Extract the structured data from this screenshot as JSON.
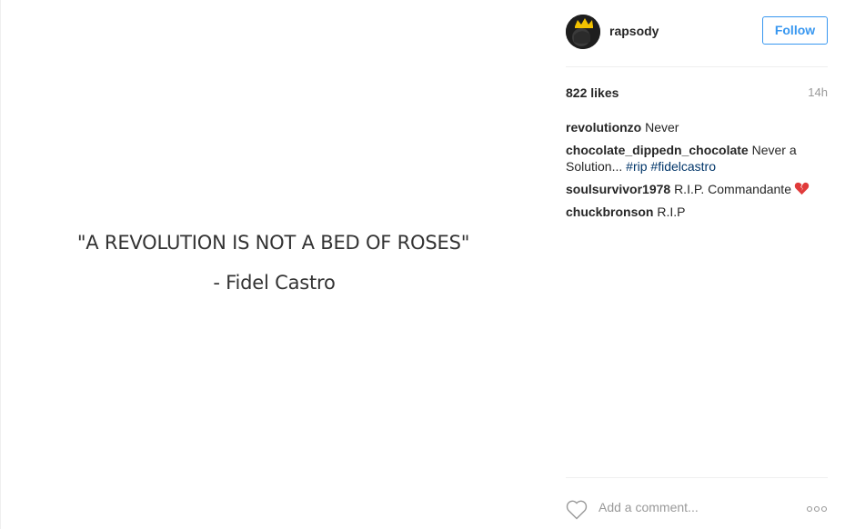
{
  "media": {
    "quote_line1": "\"A REVOLUTION IS NOT A BED OF ROSES\"",
    "quote_line2": "- Fidel Castro"
  },
  "header": {
    "username": "rapsody",
    "follow_label": "Follow",
    "follow_color": "#3897f0"
  },
  "stats": {
    "likes": "822 likes",
    "time": "14h"
  },
  "comments": [
    {
      "author": "revolutionzo",
      "text": "Never"
    },
    {
      "author": "chocolate_dippedn_chocolate",
      "text": "Never a Solution...",
      "tags": [
        "#rip",
        "#fidelcastro"
      ]
    },
    {
      "author": "soulsurvivor1978",
      "text": "R.I.P. Commandante",
      "emoji": "broken-heart-icon"
    },
    {
      "author": "chuckbronson",
      "text": "R.I.P"
    }
  ],
  "footer": {
    "comment_placeholder": "Add a comment...",
    "like_icon": "heart-icon",
    "more_icon": "more-options-icon"
  }
}
